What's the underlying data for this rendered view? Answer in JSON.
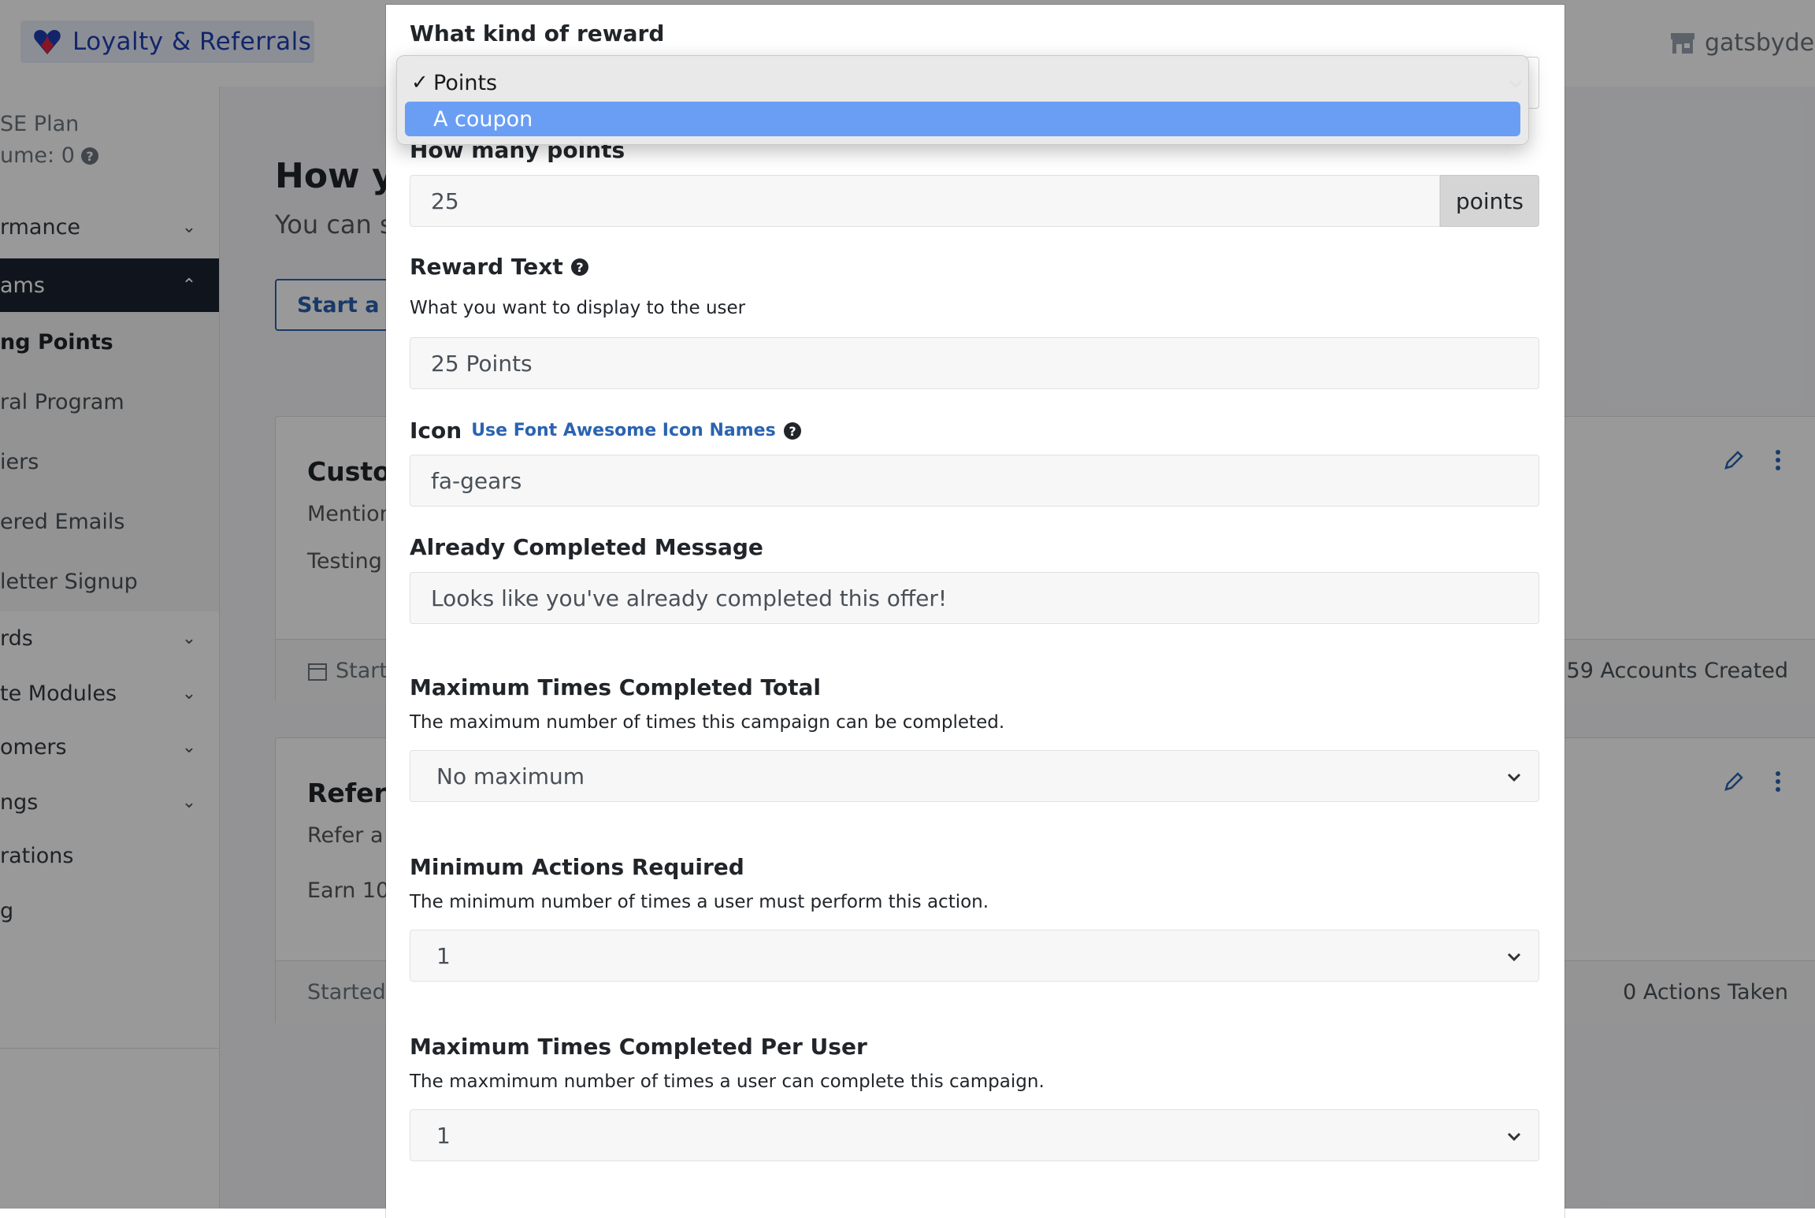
{
  "app": {
    "brand": "Loyalty & Referrals",
    "store": "gatsbydev.c",
    "accent": "#1f3fb3"
  },
  "sidebar": {
    "plan": "SE Plan",
    "volume": "ume: 0",
    "items": [
      {
        "label": "rmance",
        "chevron": "chevron-down"
      },
      {
        "label": "ams",
        "chevron": "chevron-up",
        "active": true
      },
      {
        "label": "ng Points",
        "sub": true,
        "bold": true
      },
      {
        "label": "ral Program",
        "sub": true
      },
      {
        "label": "iers",
        "sub": true
      },
      {
        "label": "ered Emails",
        "sub": true
      },
      {
        "label": "letter Signup",
        "sub": true
      },
      {
        "label": "rds",
        "chevron": "chevron-down"
      },
      {
        "label": "te Modules",
        "chevron": "chevron-down"
      },
      {
        "label": "omers",
        "chevron": "chevron-down"
      },
      {
        "label": "ngs",
        "chevron": "chevron-down"
      },
      {
        "label": "rations"
      },
      {
        "label": "g"
      }
    ]
  },
  "main": {
    "title": "How yo",
    "subtitle": "You can s",
    "start_button": "Start a Ne",
    "cards": [
      {
        "title": "Custo",
        "line1": "Mention",
        "line2": "Testing",
        "footer_left": "Start",
        "footer_right": "59 Accounts Created"
      },
      {
        "title": "Referr",
        "line1": "Refer a f",
        "line2": "Earn 10",
        "footer_left": "Started",
        "footer_right": "0 Actions Taken"
      }
    ]
  },
  "modal": {
    "reward_kind": {
      "label": "What kind of reward",
      "options": [
        "Points",
        "A coupon"
      ],
      "selected": "Points",
      "highlighted": "A coupon"
    },
    "points": {
      "label": "How many points",
      "value": "25",
      "addon": "points"
    },
    "reward_text": {
      "label": "Reward Text",
      "help": "What you want to display to the user",
      "value": "25 Points"
    },
    "icon": {
      "label": "Icon",
      "link": "Use Font Awesome Icon Names",
      "value": "fa-gears"
    },
    "completed_message": {
      "label": "Already Completed Message",
      "value": "Looks like you've already completed this offer!"
    },
    "max_total": {
      "label": "Maximum Times Completed Total",
      "help": "The maximum number of times this campaign can be completed.",
      "value": "No maximum"
    },
    "min_actions": {
      "label": "Minimum Actions Required",
      "help": "The minimum number of times a user must perform this action.",
      "value": "1"
    },
    "max_per_user": {
      "label": "Maximum Times Completed Per User",
      "help": "The maxmimum number of times a user can complete this campaign.",
      "value": "1"
    }
  }
}
